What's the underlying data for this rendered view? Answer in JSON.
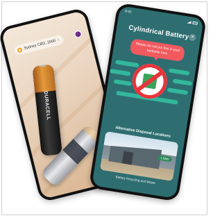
{
  "left_phone": {
    "location_label": "Sydney CBD, 2000",
    "chevron": "›",
    "battery_brand": "DURACELL"
  },
  "right_phone": {
    "status_time": "9:41",
    "title": "Cylindrical Battery",
    "close": "×",
    "alert_text": "Please do not put this in your kerbside bins",
    "section_title": "Alternative Disposal Locations",
    "facility_badge": "1.6km",
    "facility_caption": "Battery Recycling and Waste"
  },
  "colors": {
    "screen_teal": "#2e6e71",
    "alert_red": "#f05a5f",
    "accent_green": "#35c9a8",
    "no_sign_red": "#e8343b",
    "camera_button": "#6b2d87"
  },
  "icons": [
    "location-pin-icon",
    "camera-button-icon",
    "close-icon",
    "no-bin-icon",
    "signal-icon",
    "battery-status-icon"
  ]
}
